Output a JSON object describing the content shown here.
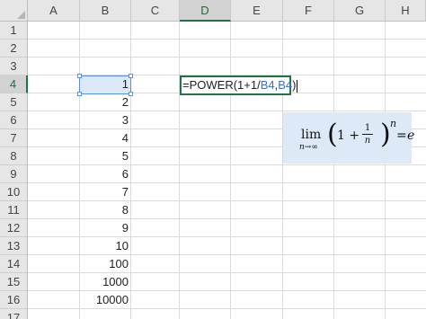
{
  "columns": [
    "A",
    "B",
    "C",
    "D",
    "E",
    "F",
    "G",
    "H"
  ],
  "rows": [
    "1",
    "2",
    "3",
    "4",
    "5",
    "6",
    "7",
    "8",
    "9",
    "10",
    "11",
    "12",
    "13",
    "14",
    "15",
    "16",
    "17"
  ],
  "active_cell": "D4",
  "column_b_values": [
    {
      "row": "4",
      "value": "1"
    },
    {
      "row": "5",
      "value": "2"
    },
    {
      "row": "6",
      "value": "3"
    },
    {
      "row": "7",
      "value": "4"
    },
    {
      "row": "8",
      "value": "5"
    },
    {
      "row": "9",
      "value": "6"
    },
    {
      "row": "10",
      "value": "7"
    },
    {
      "row": "11",
      "value": "8"
    },
    {
      "row": "12",
      "value": "9"
    },
    {
      "row": "13",
      "value": "10"
    },
    {
      "row": "14",
      "value": "100"
    },
    {
      "row": "15",
      "value": "1000"
    },
    {
      "row": "16",
      "value": "10000"
    }
  ],
  "formula_editor": {
    "prefix": "=POWER(1+1/",
    "ref1": "B4",
    "comma": ",",
    "ref2": "B4",
    "suffix": ")"
  },
  "math_box": {
    "lim": "lim",
    "subscript": "n→∞",
    "left_paren": "(",
    "one_plus": "1 +",
    "numerator": "1",
    "denominator": "n",
    "right_paren": ")",
    "exponent": "n",
    "equals": "=",
    "result": "e"
  },
  "colors": {
    "accent_green": "#217346",
    "selection_blue": "#dbe8f6",
    "reference_blue": "#3a6fc4"
  }
}
